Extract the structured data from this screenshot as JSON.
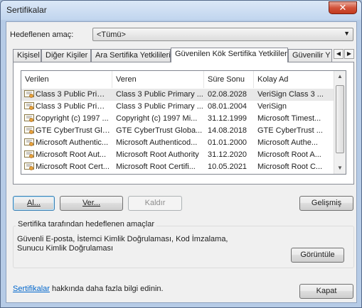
{
  "window": {
    "title": "Sertifikalar",
    "close_glyph": "✕"
  },
  "purpose": {
    "label": "Hedeflenen amaç:",
    "value": "<Tümü>",
    "arrow_icon": "chevron-down-icon"
  },
  "tabs": [
    {
      "label": "Kişisel"
    },
    {
      "label": "Diğer Kişiler"
    },
    {
      "label": "Ara Sertifika Yetkilileri"
    },
    {
      "label": "Güvenilen Kök Sertifika Yetkilileri",
      "active": true
    },
    {
      "label": "Güvenilir Y"
    }
  ],
  "table": {
    "columns": [
      "Verilen",
      "Veren",
      "Süre Sonu",
      "Kolay Ad"
    ],
    "rows": [
      [
        "Class 3 Public Prima...",
        "Class 3 Public Primary ...",
        "02.08.2028",
        "VeriSign Class 3 ..."
      ],
      [
        "Class 3 Public Prima...",
        "Class 3 Public Primary ...",
        "08.01.2004",
        "VeriSign"
      ],
      [
        "Copyright (c) 1997 ...",
        "Copyright (c) 1997 Mi...",
        "31.12.1999",
        "Microsoft Timest..."
      ],
      [
        "GTE CyberTrust Glo...",
        "GTE CyberTrust Globa...",
        "14.08.2018",
        "GTE CyberTrust ..."
      ],
      [
        "Microsoft Authentic...",
        "Microsoft Authenticod...",
        "01.01.2000",
        "Microsoft Authe..."
      ],
      [
        "Microsoft Root Aut...",
        "Microsoft Root Authority",
        "31.12.2020",
        "Microsoft Root A..."
      ],
      [
        "Microsoft Root Cert...",
        "Microsoft Root Certifi...",
        "10.05.2021",
        "Microsoft Root C..."
      ]
    ],
    "selected_row": 0
  },
  "buttons": {
    "import": "Al...",
    "export": "Ver...",
    "remove": "Kaldır",
    "advanced": "Gelişmiş",
    "view": "Görüntüle",
    "close": "Kapat"
  },
  "purposes": {
    "title": "Sertifika tarafından hedeflenen amaçlar",
    "text": "Güvenli E-posta, İstemci Kimlik Doğrulaması, Kod İmzalama, Sunucu Kimlik Doğrulaması"
  },
  "footer": {
    "link": "Sertifikalar",
    "text": " hakkında daha fazla bilgi edinin."
  },
  "colors": {
    "accent_link": "#0066cc",
    "close_button": "#c23a1e"
  }
}
